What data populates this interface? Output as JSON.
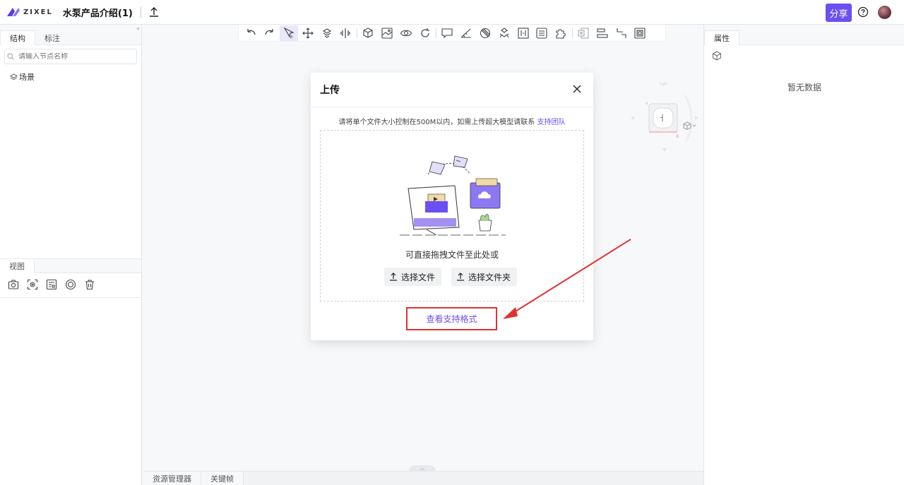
{
  "header": {
    "logo_text": "ZIXEL",
    "doc_title": "水泵产品介绍(1)",
    "share_label": "分享"
  },
  "left_panel": {
    "tabs": [
      "结构",
      "标注"
    ],
    "search_placeholder": "请输入节点名称",
    "tree": [
      {
        "label": "场景"
      }
    ],
    "view_section": {
      "tab": "视图",
      "tools": [
        "camera-icon",
        "focus-icon",
        "layout-icon",
        "target-icon",
        "trash-icon"
      ]
    }
  },
  "right_panel": {
    "tab": "属性",
    "empty_text": "暂无数据"
  },
  "toolbar": {
    "tools": [
      "undo-icon",
      "redo-icon",
      "select-pointer-icon",
      "move-icon",
      "explode-icon",
      "section-icon",
      "cube-icon",
      "material-icon",
      "view-eye-icon",
      "rotate-icon",
      "comment-icon",
      "measure-icon",
      "transparency-icon",
      "hierarchy-icon",
      "dimension-icon",
      "list-icon",
      "puzzle-icon",
      "excel-icon",
      "align-icon",
      "node-icon",
      "copy-icon"
    ],
    "active_tool": "select-pointer-icon"
  },
  "bottom_tabs": [
    "资源管理器",
    "关键帧"
  ],
  "modal": {
    "title": "上传",
    "hint": "请将单个文件大小控制在500M以内，如需上传超大模型请联系",
    "hint_link": "支持团队",
    "drop_text": "可直接拖拽文件至此处或",
    "select_file_label": "选择文件",
    "select_folder_label": "选择文件夹",
    "formats_link": "查看支持格式"
  },
  "nav_cube": {
    "axis_x": "X",
    "axis_y": "Y"
  },
  "colors": {
    "accent": "#6c4ff0",
    "highlight_red": "#e03131"
  }
}
